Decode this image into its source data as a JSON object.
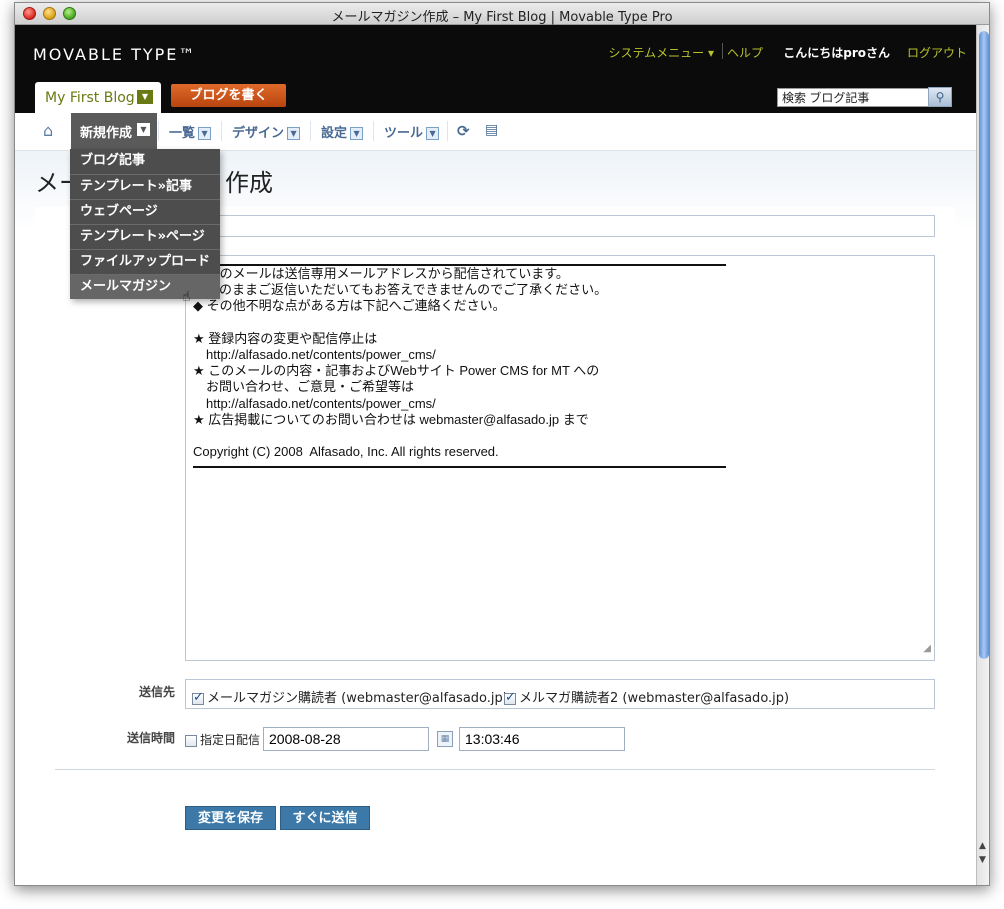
{
  "window": {
    "title": "メールマガジン作成 – My First Blog | Movable Type Pro"
  },
  "header": {
    "logo": "MOVABLE TYPE™",
    "system_menu": "システムメニュー ▾",
    "help": "ヘルプ",
    "greeting": "こんにちはproさん",
    "logout": "ログアウト",
    "blog_name": "My First Blog",
    "write_button": "ブログを書く",
    "search_value": "検索 ブログ記事"
  },
  "nav": {
    "new": "新規作成",
    "list": "一覧",
    "design": "デザイン",
    "settings": "設定",
    "tools": "ツール"
  },
  "dropdown": {
    "items": [
      "ブログ記事",
      "テンプレート»記事",
      "ウェブページ",
      "テンプレート»ページ",
      "ファイルアップロード",
      "メールマガジン"
    ]
  },
  "page": {
    "title_left": "メー",
    "title_right": "作成"
  },
  "body_lines": [
    "◆ このメールは送信専用メールアドレスから配信されています。",
    "　このままご返信いただいてもお答えできませんのでご了承ください。",
    "◆ その他不明な点がある方は下記へご連絡ください。",
    "",
    "★ 登録内容の変更や配信停止は",
    "　http://alfasado.net/contents/power_cms/",
    "★ このメールの内容・記事およびWebサイト Power CMS for MT への",
    "　お問い合わせ、ご意見・ご希望等は",
    "　http://alfasado.net/contents/power_cms/",
    "★ 広告掲載についてのお問い合わせは webmaster@alfasado.jp まで",
    "",
    "Copyright (C) 2008  Alfasado, Inc. All rights reserved."
  ],
  "form": {
    "recipients_label": "送信先",
    "recipient1": "メールマガジン購読者 (webmaster@alfasado.jp)",
    "recipient2": "メルマガ購読者2 (webmaster@alfasado.jp)",
    "schedule_label": "送信時間",
    "scheduled_delivery": "指定日配信",
    "date": "2008-08-28",
    "time": "13:03:46",
    "save_button": "変更を保存",
    "send_now_button": "すぐに送信"
  }
}
